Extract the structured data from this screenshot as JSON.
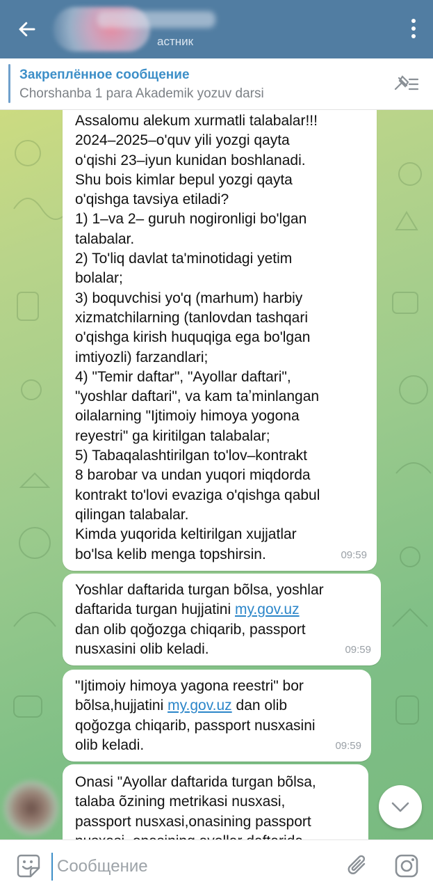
{
  "header": {
    "subtitle": "астник"
  },
  "pinned": {
    "title": "Закреплённое сообщение",
    "text": "Chorshanba 1 para Akademik yozuv darsi"
  },
  "messages": [
    {
      "lines": [
        "Assalomu alekum xurmatli talabalar!!!",
        "2024–2025–o'quv yili yozgi qayta",
        "oʻqishi 23–iyun kunidan boshlanadi.",
        "Shu bois kimlar bepul yozgi qayta",
        "o'qishga tavsiya etiladi?",
        "1) 1–va 2– guruh nogironligi bo'lgan",
        "talabalar.",
        "2) To'liq davlat ta'minotidagi yetim",
        "bolalar;",
        "3) boquvchisi yo'q (marhum) harbiy",
        "xizmatchilarning (tanlovdan tashqari",
        "o'qishga kirish huquqiga ega bo'lgan",
        "imtiyozli) farzandlari;",
        "4) \"Temir daftar\", \"Ayollar daftari\",",
        "\"yoshlar daftari\", va kam taʼminlangan",
        "oilalarning \"Ijtimoiy himoya yogona",
        "reyestri\" ga kiritilgan talabalar;",
        "5) Tabaqalashtirilgan to'lov–kontrakt",
        "8 barobar va undan yuqori miqdorda",
        "kontrakt to'lovi evaziga o'qishga qabul",
        "qilingan talabalar.",
        "Kimda yuqorida keltirilgan xujjatlar",
        "bo'lsa kelib menga topshirsin."
      ],
      "time": "09:59"
    },
    {
      "line1": "Yoshlar daftarida turgan bõlsa, yoshlar",
      "line2_pre": "daftarida turgan hujjatini ",
      "link": "my.gov.uz",
      "line3": "dan olib qoğozga chiqarib, passport",
      "line4": "nusxasini olib keladi.",
      "time": "09:59"
    },
    {
      "line1": "\"Ijtimoiy himoya yagona reestri\" bor",
      "line2_pre": "bõlsa,hujjatini ",
      "link": "my.gov.uz",
      "line2_post": " dan olib",
      "line3": "qoğozga chiqarib, passport nusxasini",
      "line4": "olib keladi.",
      "time": "09:59"
    },
    {
      "lines": [
        "Onasi \"Ayollar daftarida turgan bõlsa,",
        "talaba õzining metrikasi nusxasi,",
        "passport nusxasi,onasining passport",
        "nusxasi, onasining ayollar daftarida"
      ]
    }
  ],
  "input": {
    "placeholder": "Сообщение"
  },
  "icons": {
    "back": "back-arrow-icon",
    "menu": "more-vertical-icon",
    "pinned_list": "pinned-list-icon",
    "scroll_down": "chevron-down-icon",
    "emoji": "emoji-icon",
    "attach": "paperclip-icon",
    "camera": "camera-icon"
  },
  "colors": {
    "header": "#517da2",
    "accent": "#3d8fc8",
    "link": "#2c86c9"
  }
}
